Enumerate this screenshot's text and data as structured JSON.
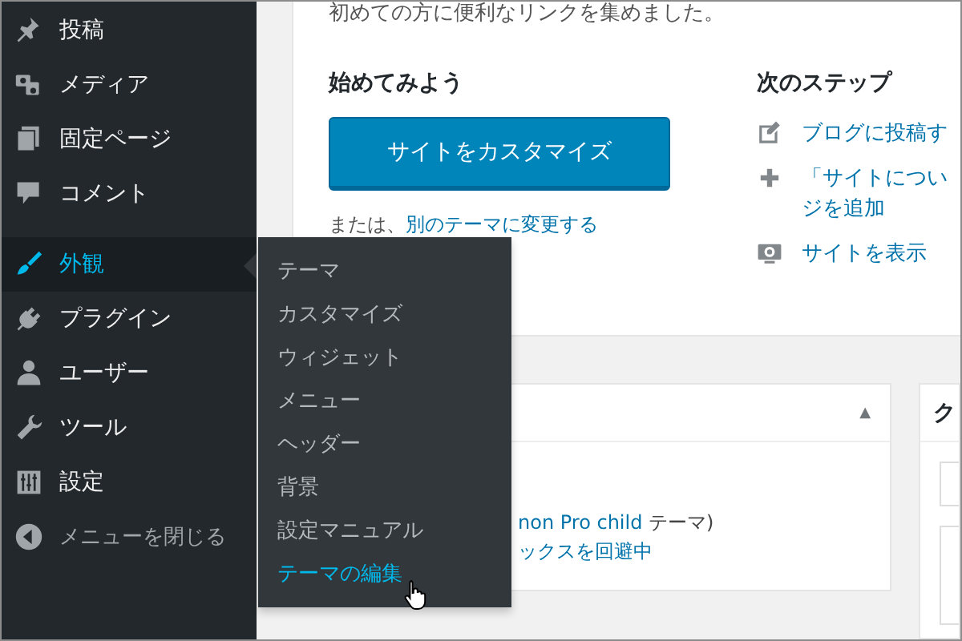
{
  "sidebar": {
    "items": [
      {
        "label": "投稿",
        "selected": false
      },
      {
        "label": "メディア",
        "selected": false
      },
      {
        "label": "固定ページ",
        "selected": false
      },
      {
        "label": "コメント",
        "selected": false
      },
      {
        "label": "外観",
        "selected": true
      },
      {
        "label": "プラグイン",
        "selected": false
      },
      {
        "label": "ユーザー",
        "selected": false
      },
      {
        "label": "ツール",
        "selected": false
      },
      {
        "label": "設定",
        "selected": false
      }
    ],
    "collapse": "メニューを閉じる"
  },
  "flyout": {
    "items": [
      {
        "label": "テーマ",
        "selected": false
      },
      {
        "label": "カスタマイズ",
        "selected": false
      },
      {
        "label": "ウィジェット",
        "selected": false
      },
      {
        "label": "メニュー",
        "selected": false
      },
      {
        "label": "ヘッダー",
        "selected": false
      },
      {
        "label": "背景",
        "selected": false
      },
      {
        "label": "設定マニュアル",
        "selected": false
      },
      {
        "label": "テーマの編集",
        "selected": true
      }
    ]
  },
  "welcome": {
    "intro": "初めての方に便利なリンクを集めました。",
    "get_started": {
      "heading": "始めてみよう",
      "button": "サイトをカスタマイズ",
      "alt_prefix": "または、",
      "alt_link": "別のテーマに変更する"
    },
    "next_steps": {
      "heading": "次のステップ",
      "items": [
        {
          "lines": [
            "ブログに投稿す"
          ]
        },
        {
          "lines": [
            "「サイトについ",
            "ジを追加"
          ]
        },
        {
          "lines": [
            "サイトを表示"
          ]
        }
      ]
    }
  },
  "panel": {
    "toggle": "▲",
    "lines": [
      {
        "link": "non Pro child",
        "text": " テーマ)"
      },
      {
        "link": "ックスを回避中"
      }
    ]
  },
  "side_card": {
    "heading": "ク"
  }
}
